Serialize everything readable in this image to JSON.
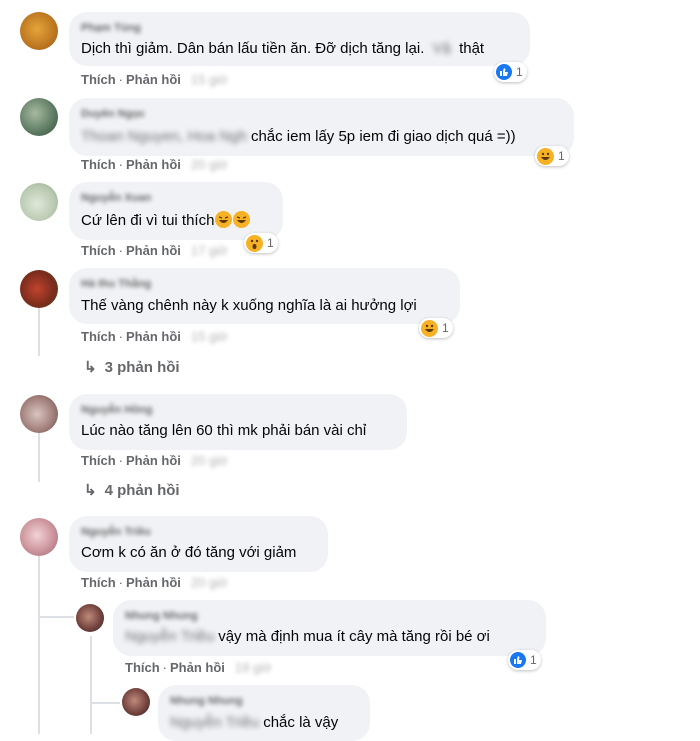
{
  "labels": {
    "like": "Thích",
    "reply": "Phản hồi"
  },
  "colors": {
    "like_blue": "#1877f2",
    "reaction_yellow": "#f7b125",
    "action_gray": "#65676b",
    "bubble_bg": "#f0f2f5"
  },
  "comments": [
    {
      "name": "Phạm Tùng",
      "text": "Dịch thì giảm. Dân bán lấu tiền ăn. Đỡ dịch tăng lại.",
      "text_blur": "Vậ",
      "text_tail": "thật",
      "time": "15 giờ",
      "reaction": {
        "icon": "like-icon",
        "count": "1"
      }
    },
    {
      "name": "Duyên Ngọc",
      "mention": "Thoan Nguyen, Hoa Ngh",
      "text": "chắc iem lấy 5p iem đi giao dịch quá =))",
      "time": "20 giờ",
      "reaction": {
        "icon": "haha-icon",
        "count": "1"
      }
    },
    {
      "name": "Nguyễn Xuan",
      "text": "Cứ lên đi vì tui thích",
      "time": "17 giờ",
      "reaction": {
        "icon": "wow-icon",
        "count": "1"
      }
    },
    {
      "name": "Hà thu Thằng",
      "text": "Thế vàng chênh này k xuống nghĩa là ai hưởng lợi",
      "time": "15 giờ",
      "reaction": {
        "icon": "haha-icon",
        "count": "1"
      },
      "replies": "3 phản hồi"
    },
    {
      "name": "Nguyễn Hồng",
      "text": "Lúc nào tăng lên 60 thì mk phải bán vài chỉ",
      "time": "20 giờ",
      "replies": "4 phản hồi"
    },
    {
      "name": "Nguyễn Triều",
      "text": "Cơm k có ăn ở đó tăng với giảm",
      "time": "20 giờ"
    }
  ],
  "nested": [
    {
      "name": "Nhung Nhung",
      "mention": "Nguyễn Triều",
      "text": "vậy mà định mua ít cây mà tăng rồi bé ơi",
      "time": "19 giờ",
      "reaction": {
        "icon": "like-icon",
        "count": "1"
      }
    },
    {
      "name": "Nhung Nhung",
      "mention": "Nguyễn Triều",
      "text": "chắc là vậy"
    }
  ]
}
